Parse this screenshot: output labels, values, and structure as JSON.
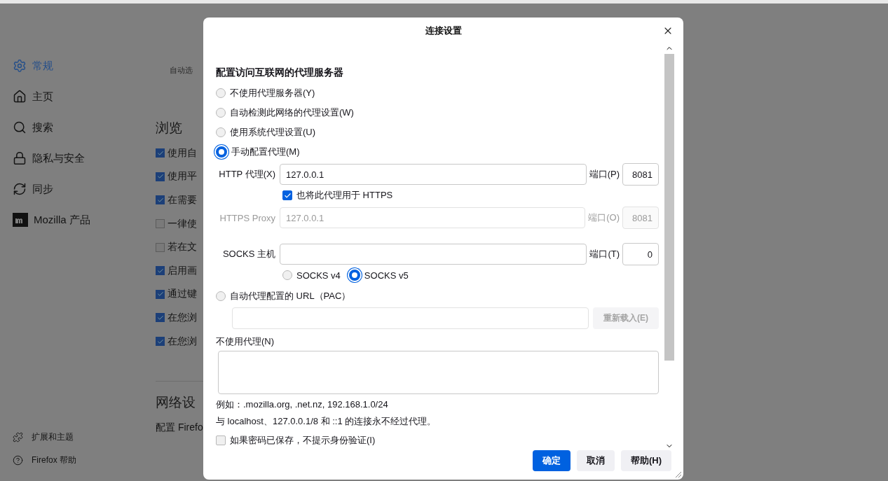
{
  "sidebar": {
    "items": [
      {
        "label": "常规",
        "selected": true
      },
      {
        "label": "主页",
        "selected": false
      },
      {
        "label": "搜索",
        "selected": false
      },
      {
        "label": "隐私与安全",
        "selected": false
      },
      {
        "label": "同步",
        "selected": false
      },
      {
        "label": "Mozilla 产品",
        "selected": false
      }
    ],
    "footer": [
      {
        "label": "扩展和主题"
      },
      {
        "label": "Firefox 帮助"
      }
    ]
  },
  "page": {
    "top_text": "自动选",
    "section": "浏览",
    "checkboxes": [
      {
        "label": "使用自",
        "checked": true
      },
      {
        "label": "使用平",
        "checked": true
      },
      {
        "label": "在需要",
        "checked": true
      },
      {
        "label": "一律使",
        "checked": false
      },
      {
        "label": "若在文",
        "checked": false
      },
      {
        "label": "启用画",
        "checked": true
      },
      {
        "label": "通过键",
        "checked": true
      },
      {
        "label": "在您浏",
        "checked": true
      },
      {
        "label": "在您浏",
        "checked": true
      }
    ],
    "section2": "网络设",
    "network_text": "配置 Firefo"
  },
  "dialog": {
    "title": "连接设置",
    "heading": "配置访问互联网的代理服务器",
    "proxy_modes": [
      {
        "label": "不使用代理服务器(Y)",
        "selected": false
      },
      {
        "label": "自动检测此网络的代理设置(W)",
        "selected": false
      },
      {
        "label": "使用系统代理设置(U)",
        "selected": false
      },
      {
        "label": "手动配置代理(M)",
        "selected": true
      }
    ],
    "http": {
      "label": "HTTP 代理(X)",
      "value": "127.0.0.1",
      "port_label": "端口(P)",
      "port": "8081",
      "disabled": false
    },
    "also_https": {
      "label": "也将此代理用于 HTTPS",
      "checked": true
    },
    "https": {
      "label": "HTTPS Proxy",
      "value": "127.0.0.1",
      "port_label": "端口(O)",
      "port": "8081",
      "disabled": true
    },
    "socks": {
      "label": "SOCKS 主机",
      "port_label": "端口(T)",
      "port": "0",
      "disabled": false
    },
    "socks_versions": [
      {
        "label": "SOCKS v4",
        "selected": false
      },
      {
        "label": "SOCKS v5",
        "selected": true
      }
    ],
    "pac": {
      "label": "自动代理配置的 URL（PAC）",
      "selected": false,
      "reload": "重新载入(E)",
      "reload_disabled": true
    },
    "no_proxy": {
      "label": "不使用代理(N)"
    },
    "example": "例如：.mozilla.org, .net.nz, 192.168.1.0/24",
    "note": "与 localhost、127.0.0.1/8 和 ::1 的连接永不经过代理。",
    "no_auth": {
      "label": "如果密码已保存，不提示身份验证(I)",
      "checked": false
    },
    "buttons": [
      {
        "label": "确定",
        "kind": "primary"
      },
      {
        "label": "取消",
        "kind": "secondary"
      },
      {
        "label": "帮助(H)",
        "kind": "secondary"
      }
    ]
  }
}
